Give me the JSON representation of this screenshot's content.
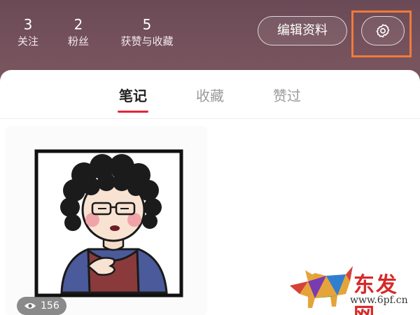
{
  "profile_stats": {
    "follow": {
      "count": "3",
      "label": "关注"
    },
    "fans": {
      "count": "2",
      "label": "粉丝"
    },
    "likes": {
      "count": "5",
      "label": "获赞与收藏"
    }
  },
  "header": {
    "edit_profile_label": "编辑资料",
    "settings_icon": "gear-icon",
    "highlight_color": "#f07a3a"
  },
  "tabs": [
    {
      "label": "笔记",
      "active": true
    },
    {
      "label": "收藏",
      "active": false
    },
    {
      "label": "赞过",
      "active": false
    }
  ],
  "note_card": {
    "image": "cartoon-woman-illustration",
    "views": "156",
    "views_icon": "eye-icon"
  },
  "watermark": {
    "brand": "东发网",
    "url": "www.6pf.cn"
  },
  "colors": {
    "header_bg": "#76525d",
    "accent": "#e4253a"
  }
}
